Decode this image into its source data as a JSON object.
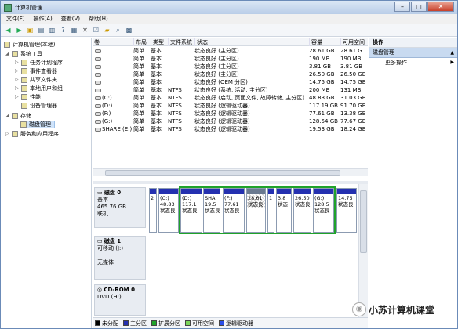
{
  "window": {
    "title": "计算机管理"
  },
  "menu": [
    "文件(F)",
    "操作(A)",
    "查看(V)",
    "帮助(H)"
  ],
  "tree": {
    "root": "计算机管理(本地)",
    "system_tools": "系统工具",
    "task_scheduler": "任务计划程序",
    "event_viewer": "事件查看器",
    "shared_folders": "共享文件夹",
    "local_users": "本地用户和组",
    "performance": "性能",
    "device_manager": "设备管理器",
    "storage": "存储",
    "disk_management": "磁盘管理",
    "services": "服务和应用程序"
  },
  "columns": [
    "卷",
    "布局",
    "类型",
    "文件系统",
    "状态",
    "容量",
    "可用空间"
  ],
  "volumes": [
    {
      "name": "",
      "layout": "简单",
      "type": "基本",
      "fs": "",
      "status": "状态良好 (主分区)",
      "cap": "28.61 GB",
      "free": "28.61 G"
    },
    {
      "name": "",
      "layout": "简单",
      "type": "基本",
      "fs": "",
      "status": "状态良好 (主分区)",
      "cap": "190 MB",
      "free": "190 MB"
    },
    {
      "name": "",
      "layout": "简单",
      "type": "基本",
      "fs": "",
      "status": "状态良好 (主分区)",
      "cap": "3.81 GB",
      "free": "3.81 GB"
    },
    {
      "name": "",
      "layout": "简单",
      "type": "基本",
      "fs": "",
      "status": "状态良好 (主分区)",
      "cap": "26.50 GB",
      "free": "26.50 GB"
    },
    {
      "name": "",
      "layout": "简单",
      "type": "基本",
      "fs": "",
      "status": "状态良好 (OEM 分区)",
      "cap": "14.75 GB",
      "free": "14.75 GB"
    },
    {
      "name": "",
      "layout": "简单",
      "type": "基本",
      "fs": "NTFS",
      "status": "状态良好 (系统, 活动, 主分区)",
      "cap": "200 MB",
      "free": "131 MB"
    },
    {
      "name": "(C:)",
      "layout": "简单",
      "type": "基本",
      "fs": "NTFS",
      "status": "状态良好 (启动, 页面文件, 故障转储, 主分区)",
      "cap": "48.83 GB",
      "free": "31.03 GB"
    },
    {
      "name": "(D:)",
      "layout": "简单",
      "type": "基本",
      "fs": "NTFS",
      "status": "状态良好 (逻辑驱动器)",
      "cap": "117.19 GB",
      "free": "91.70 GB"
    },
    {
      "name": "(F:)",
      "layout": "简单",
      "type": "基本",
      "fs": "NTFS",
      "status": "状态良好 (逻辑驱动器)",
      "cap": "77.61 GB",
      "free": "13.38 GB"
    },
    {
      "name": "(G:)",
      "layout": "简单",
      "type": "基本",
      "fs": "NTFS",
      "status": "状态良好 (逻辑驱动器)",
      "cap": "128.54 GB",
      "free": "77.67 GB"
    },
    {
      "name": "SHARE (E:)",
      "layout": "简单",
      "type": "基本",
      "fs": "NTFS",
      "status": "状态良好 (逻辑驱动器)",
      "cap": "19.53 GB",
      "free": "18.24 GB"
    }
  ],
  "disk0": {
    "title": "磁盘 0",
    "type": "基本",
    "size": "465.76 GB",
    "status": "联机",
    "partitions": [
      {
        "l1": "2",
        "l2": "",
        "l3": ""
      },
      {
        "l1": "(C:)",
        "l2": "48.83",
        "l3": "状态良"
      },
      {
        "l1": "(D:)",
        "l2": "117.1",
        "l3": "状态良"
      },
      {
        "l1": "SHA",
        "l2": "19.5",
        "l3": "状态良"
      },
      {
        "l1": "(F:)",
        "l2": "77.61",
        "l3": "状态良"
      },
      {
        "l1": "28.61",
        "l2": "状态良",
        "l3": ""
      },
      {
        "l1": "1",
        "l2": "",
        "l3": ""
      },
      {
        "l1": "3.8",
        "l2": "状态",
        "l3": ""
      },
      {
        "l1": "26.50",
        "l2": "状态良",
        "l3": ""
      },
      {
        "l1": "(G:)",
        "l2": "128.5",
        "l3": "状态良"
      },
      {
        "l1": "14.75",
        "l2": "状态良",
        "l3": ""
      }
    ]
  },
  "disk1": {
    "title": "磁盘 1",
    "type": "可移动 (J:)",
    "status": "无媒体"
  },
  "cdrom": {
    "title": "CD-ROM 0",
    "type": "DVD (H:)"
  },
  "legend": [
    {
      "label": "未分配",
      "color": "#000000"
    },
    {
      "label": "主分区",
      "color": "#2430b0"
    },
    {
      "label": "扩展分区",
      "color": "#1fa32a"
    },
    {
      "label": "可用空间",
      "color": "#7ad45a"
    },
    {
      "label": "逻辑驱动器",
      "color": "#2a4ee8"
    }
  ],
  "actions": {
    "header": "操作",
    "section": "磁盘管理",
    "more": "更多操作"
  },
  "watermark": "小苏计算机课堂"
}
